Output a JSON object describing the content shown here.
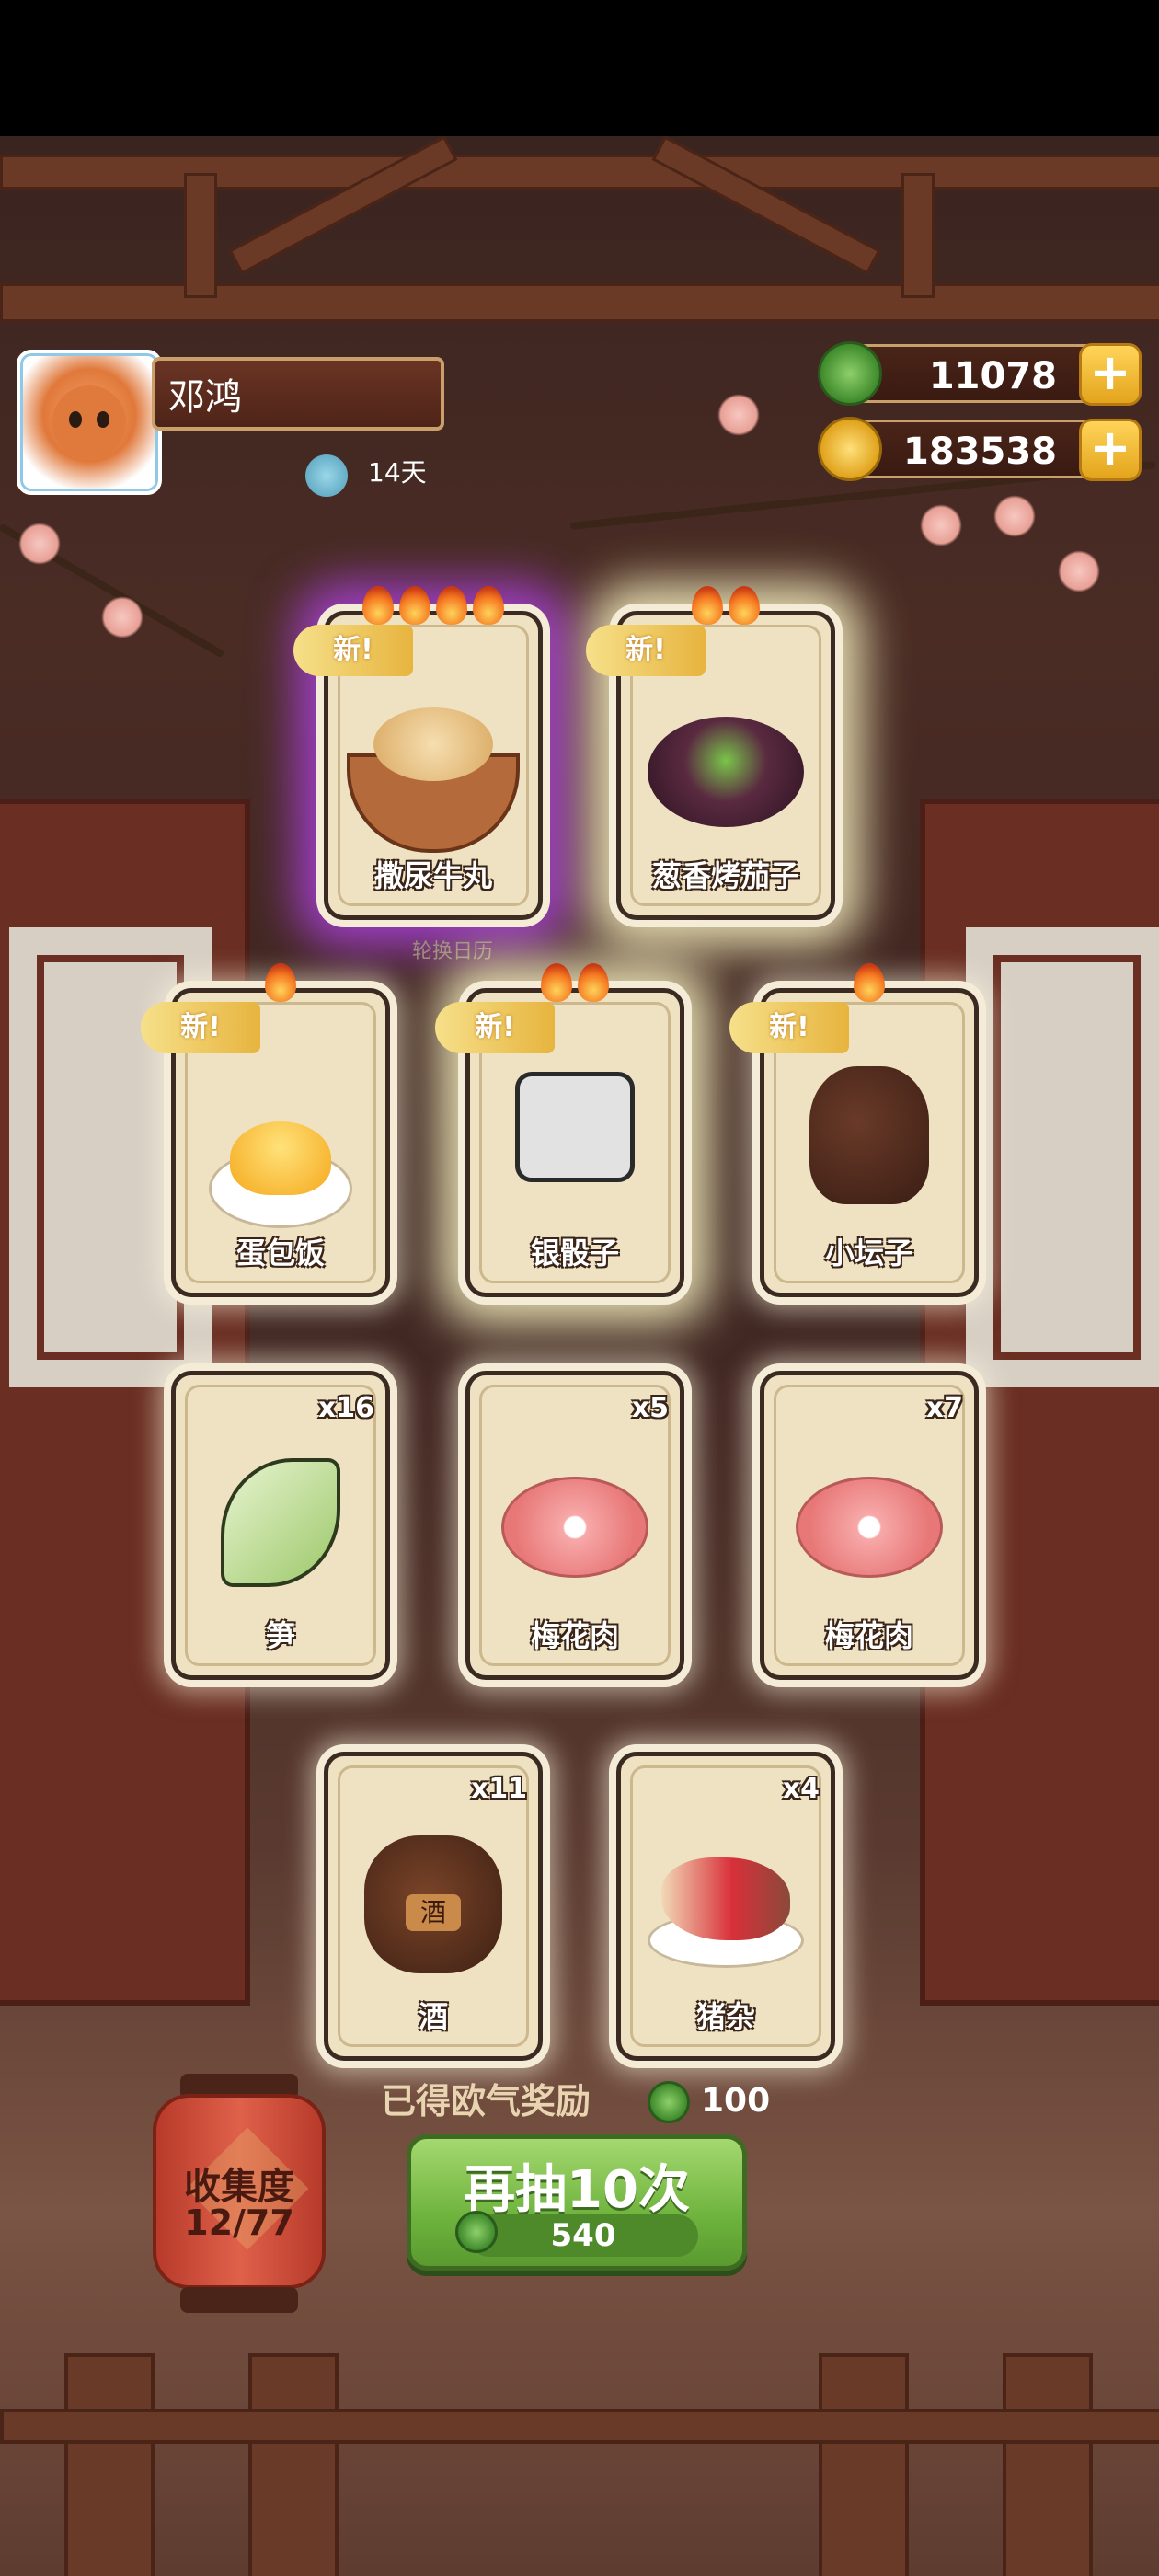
{
  "player": {
    "name": "邓鸿",
    "days": "14天"
  },
  "currency": {
    "jade": "11078",
    "coins": "183538"
  },
  "new_badge": "新",
  "cards": [
    {
      "label": "撒尿牛丸",
      "is_new": true,
      "flames": 4,
      "glow": "purple"
    },
    {
      "label": "葱香烤茄子",
      "is_new": true,
      "flames": 2,
      "glow": "gold"
    },
    {
      "label": "蛋包饭",
      "is_new": true,
      "flames": 1,
      "glow": "normal"
    },
    {
      "label": "银骰子",
      "is_new": true,
      "flames": 2,
      "glow": "normal"
    },
    {
      "label": "小坛子",
      "is_new": true,
      "flames": 1,
      "glow": "normal"
    },
    {
      "label": "笋",
      "count": "x16"
    },
    {
      "label": "梅花肉",
      "count": "x5"
    },
    {
      "label": "梅花肉",
      "count": "x7"
    },
    {
      "label": "酒",
      "count": "x11"
    },
    {
      "label": "猪杂",
      "count": "x4"
    }
  ],
  "rotate_calendar_label": "轮换日历",
  "reward": {
    "label": "已得欧气奖励",
    "value": "100"
  },
  "draw_again": {
    "label": "再抽10次",
    "cost": "540"
  },
  "collection": {
    "label": "收集度",
    "progress": "12/77"
  },
  "colors": {
    "accent_green": "#6fb43e",
    "gold": "#e7b43e",
    "lantern_red": "#e0614a",
    "purple_glow": "#be46ff"
  }
}
